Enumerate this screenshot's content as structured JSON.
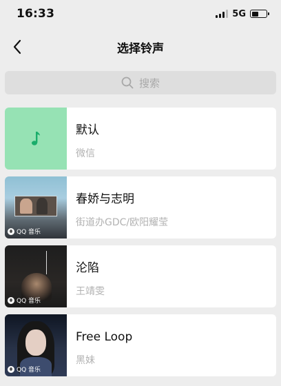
{
  "status_bar": {
    "time": "16:33",
    "network": "5G",
    "battery_level": 0.45
  },
  "nav": {
    "title": "选择铃声",
    "back_icon": "chevron-left-icon"
  },
  "search": {
    "placeholder": "搜索",
    "icon": "search-icon"
  },
  "ringtones": [
    {
      "title": "默认",
      "subtitle": "微信",
      "cover": "music-note-icon"
    },
    {
      "title": "春娇与志明",
      "subtitle": "街道办GDC/欧阳耀莹",
      "badge": "QQ 音乐"
    },
    {
      "title": "沦陷",
      "subtitle": "王靖雯",
      "badge": "QQ 音乐"
    },
    {
      "title": "Free Loop",
      "subtitle": "黑妹",
      "badge": "QQ 音乐"
    }
  ],
  "colors": {
    "background": "#ededed",
    "default_cover": "#96e2b4",
    "note": "#1aad6b"
  }
}
